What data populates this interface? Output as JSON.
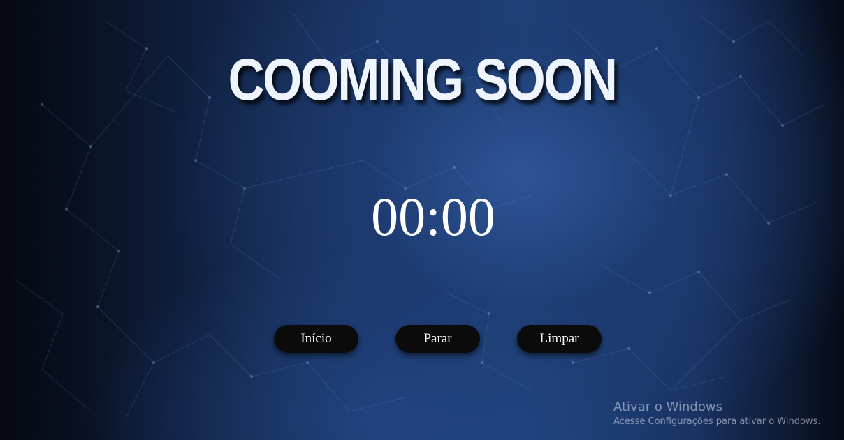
{
  "title": "COOMING SOON",
  "timer": {
    "display": "00:00"
  },
  "buttons": {
    "start_label": "Início",
    "stop_label": "Parar",
    "clear_label": "Limpar"
  },
  "watermark": {
    "title": "Ativar o Windows",
    "subtitle": "Acesse Configurações para ativar o Windows."
  },
  "colors": {
    "background": "#1f4178",
    "button": "#0b0b0c",
    "title_text": "#eef5ff"
  }
}
